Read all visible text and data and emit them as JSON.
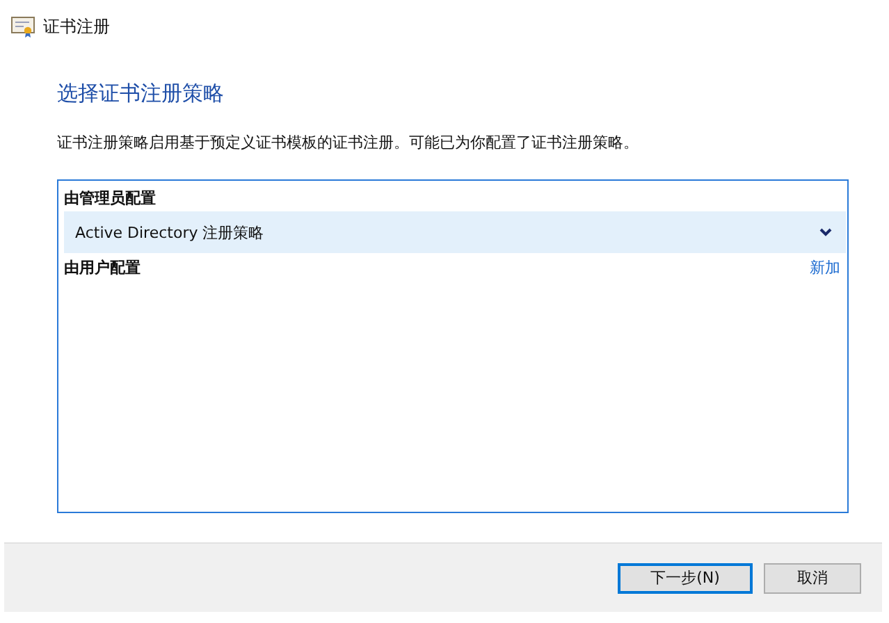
{
  "window": {
    "title": "证书注册"
  },
  "heading": "选择证书注册策略",
  "description": "证书注册策略启用基于预定义证书模板的证书注册。可能已为你配置了证书注册策略。",
  "policy_list": {
    "groups": [
      {
        "label": "由管理员配置",
        "items": [
          {
            "label": "Active Directory 注册策略",
            "selected": true,
            "expanded": false
          }
        ]
      },
      {
        "label": "由用户配置",
        "action": "新加"
      }
    ]
  },
  "buttons": [
    {
      "label": "下一步(N)",
      "default": true
    },
    {
      "label": "取消",
      "default": false
    }
  ]
}
